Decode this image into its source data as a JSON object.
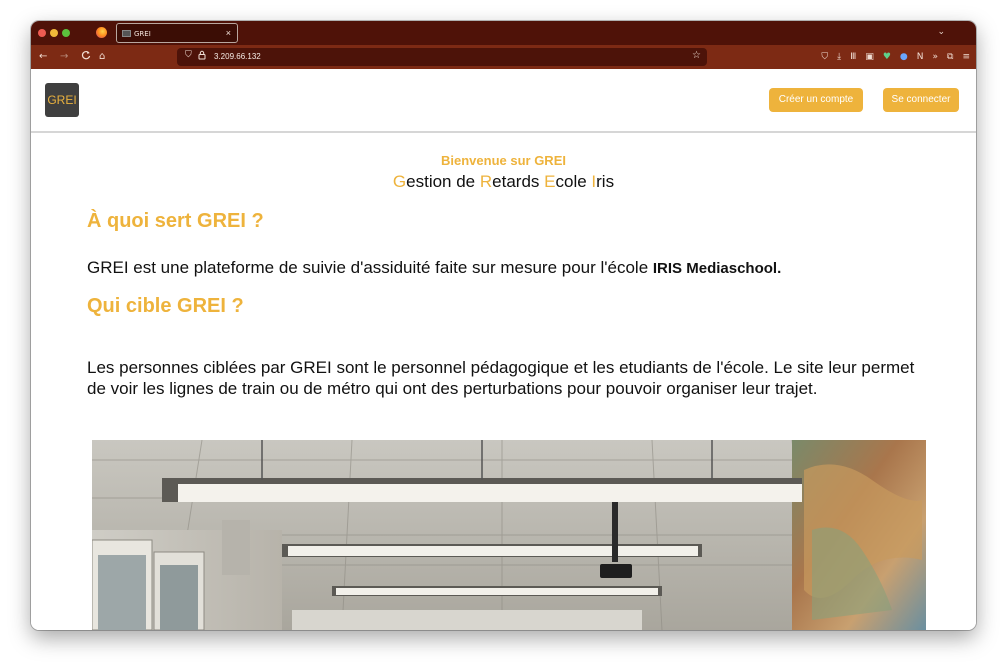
{
  "browser": {
    "tab_title": "GREI",
    "tab_close": "×",
    "tabs_menu_icon": "⌄",
    "url": "3.209.66.132",
    "nav_icons": {
      "back": "←",
      "forward": "→",
      "reload": "C",
      "home": "⌂"
    },
    "url_icons": {
      "shield": "⛉",
      "lock": "🔒",
      "bookmark": "☆"
    },
    "toolbar_icons": [
      "pocket-icon",
      "download-icon",
      "library-icon",
      "sidebar-icon",
      "shield-extension-icon",
      "privacy-extension-icon",
      "notion-extension-icon",
      "overflow-icon",
      "extensions-icon",
      "menu-icon"
    ],
    "toolbar_glyphs": [
      "⛉",
      "⤓",
      "Ⅲ",
      "▣",
      "♥",
      "●",
      "N",
      "»",
      "⧉",
      "≡"
    ]
  },
  "site": {
    "logo_text": "GREI",
    "signup_label": "Créer un compte",
    "login_label": "Se connecter",
    "welcome": "Bienvenue sur GREI",
    "acronym": [
      {
        "initial": "G",
        "rest": "estion de "
      },
      {
        "initial": "R",
        "rest": "etards "
      },
      {
        "initial": "E",
        "rest": "cole "
      },
      {
        "initial": "I",
        "rest": "ris"
      }
    ],
    "section1_title": "À quoi sert GREI ?",
    "section1_text": "GREI est une plateforme de suivie d'assiduité faite sur mesure pour l'école ",
    "section1_strong": "IRIS Mediaschool.",
    "section2_title": "Qui cible GREI ?",
    "section2_text": "Les personnes ciblées par GREI sont le personnel pédagogique et les etudiants de l'école. Le site leur permet de voir les lignes de train ou de métro qui ont des perturbations pour pouvoir organiser leur trajet."
  },
  "colors": {
    "accent": "#eeb33c",
    "tabbar": "#4f1208",
    "navbar": "#7d2a14",
    "text": "#111111"
  }
}
